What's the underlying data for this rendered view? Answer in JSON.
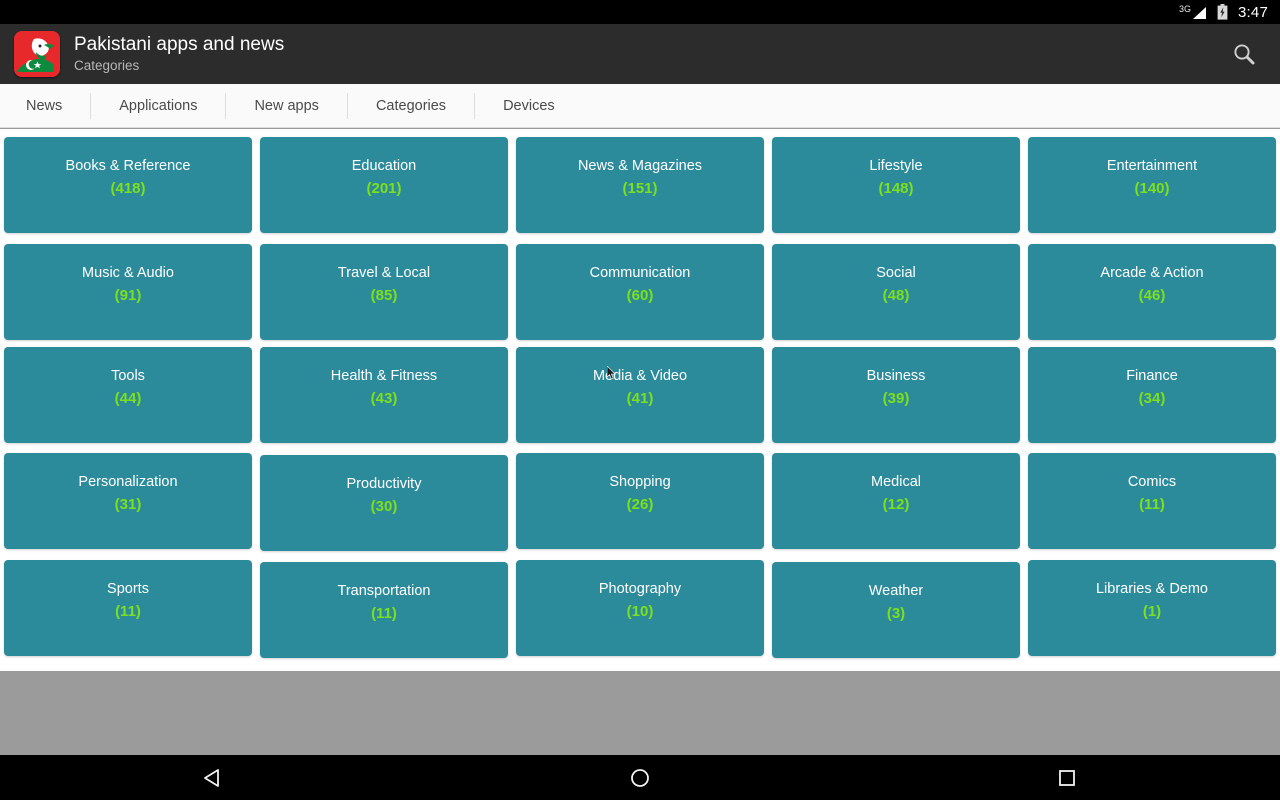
{
  "statusbar": {
    "network_label": "3G",
    "network_icon": "signal-3g-icon",
    "battery_icon": "battery-charging-icon",
    "time": "3:47"
  },
  "actionbar": {
    "app_icon": "pakistan-flag-app-icon",
    "title": "Pakistani apps and news",
    "subtitle": "Categories",
    "search_icon": "search-icon"
  },
  "tabs": [
    {
      "label": "News"
    },
    {
      "label": "Applications"
    },
    {
      "label": "New apps"
    },
    {
      "label": "Categories"
    },
    {
      "label": "Devices"
    }
  ],
  "colors": {
    "tile": "#2c8b9b",
    "count": "#7ce01a",
    "actionbar": "#2c2c2c",
    "background": "#9b9b9b",
    "app_icon_red": "#e8292b"
  },
  "categories": [
    [
      {
        "name": "Books & Reference",
        "count": "(418)"
      },
      {
        "name": "Education",
        "count": "(201)"
      },
      {
        "name": "News & Magazines",
        "count": "(151)"
      },
      {
        "name": "Lifestyle",
        "count": "(148)"
      },
      {
        "name": "Entertainment",
        "count": "(140)"
      }
    ],
    [
      {
        "name": "Music & Audio",
        "count": "(91)"
      },
      {
        "name": "Travel & Local",
        "count": "(85)"
      },
      {
        "name": "Communication",
        "count": "(60)"
      },
      {
        "name": "Social",
        "count": "(48)"
      },
      {
        "name": "Arcade & Action",
        "count": "(46)"
      }
    ],
    [
      {
        "name": "Tools",
        "count": "(44)"
      },
      {
        "name": "Health & Fitness",
        "count": "(43)"
      },
      {
        "name": "Media & Video",
        "count": "(41)"
      },
      {
        "name": "Business",
        "count": "(39)"
      },
      {
        "name": "Finance",
        "count": "(34)"
      }
    ],
    [
      {
        "name": "Personalization",
        "count": "(31)"
      },
      {
        "name": "Productivity",
        "count": "(30)"
      },
      {
        "name": "Shopping",
        "count": "(26)"
      },
      {
        "name": "Medical",
        "count": "(12)"
      },
      {
        "name": "Comics",
        "count": "(11)"
      }
    ],
    [
      {
        "name": "Sports",
        "count": "(11)"
      },
      {
        "name": "Transportation",
        "count": "(11)"
      },
      {
        "name": "Photography",
        "count": "(10)"
      },
      {
        "name": "Weather",
        "count": "(3)"
      },
      {
        "name": "Libraries & Demo",
        "count": "(1)"
      }
    ]
  ],
  "navbar": [
    {
      "icon": "back-nav-icon"
    },
    {
      "icon": "home-nav-icon"
    },
    {
      "icon": "recents-nav-icon"
    }
  ]
}
